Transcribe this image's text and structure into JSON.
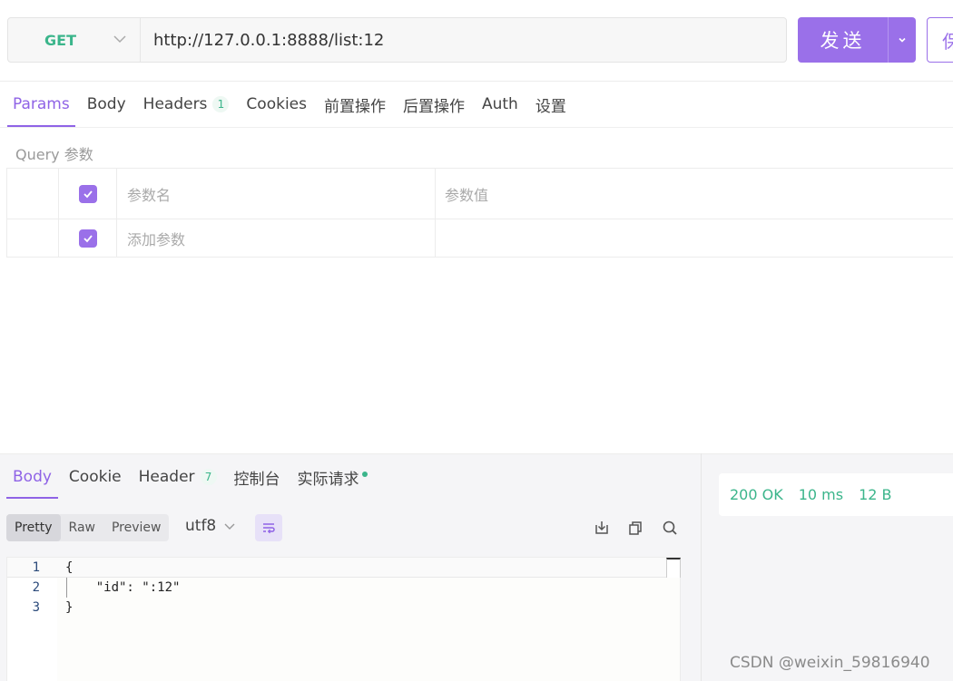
{
  "request": {
    "method": "GET",
    "url": "http://127.0.0.1:8888/list:12",
    "send_label": "发送",
    "save_label": "保"
  },
  "request_tabs": [
    {
      "label": "Params",
      "active": true
    },
    {
      "label": "Body"
    },
    {
      "label": "Headers",
      "badge": "1"
    },
    {
      "label": "Cookies"
    },
    {
      "label": "前置操作"
    },
    {
      "label": "后置操作"
    },
    {
      "label": "Auth"
    },
    {
      "label": "设置"
    }
  ],
  "params": {
    "section_label": "Query 参数",
    "header_name": "参数名",
    "header_value": "参数值",
    "add_placeholder": "添加参数"
  },
  "response_tabs": [
    {
      "label": "Body",
      "active": true
    },
    {
      "label": "Cookie"
    },
    {
      "label": "Header",
      "badge": "7"
    },
    {
      "label": "控制台"
    },
    {
      "label": "实际请求",
      "dot": true
    }
  ],
  "view_modes": [
    "Pretty",
    "Raw",
    "Preview"
  ],
  "encoding": "utf8",
  "editor": {
    "lines": [
      {
        "num": "1",
        "code": "{"
      },
      {
        "num": "2",
        "code": "    \"id\": \":12\""
      },
      {
        "num": "3",
        "code": "}"
      }
    ]
  },
  "status": {
    "code": "200 OK",
    "time": "10 ms",
    "size": "12 B"
  },
  "watermark": "CSDN @weixin_59816940",
  "colors": {
    "accent": "#9a70e9",
    "success": "#3bb58b"
  }
}
